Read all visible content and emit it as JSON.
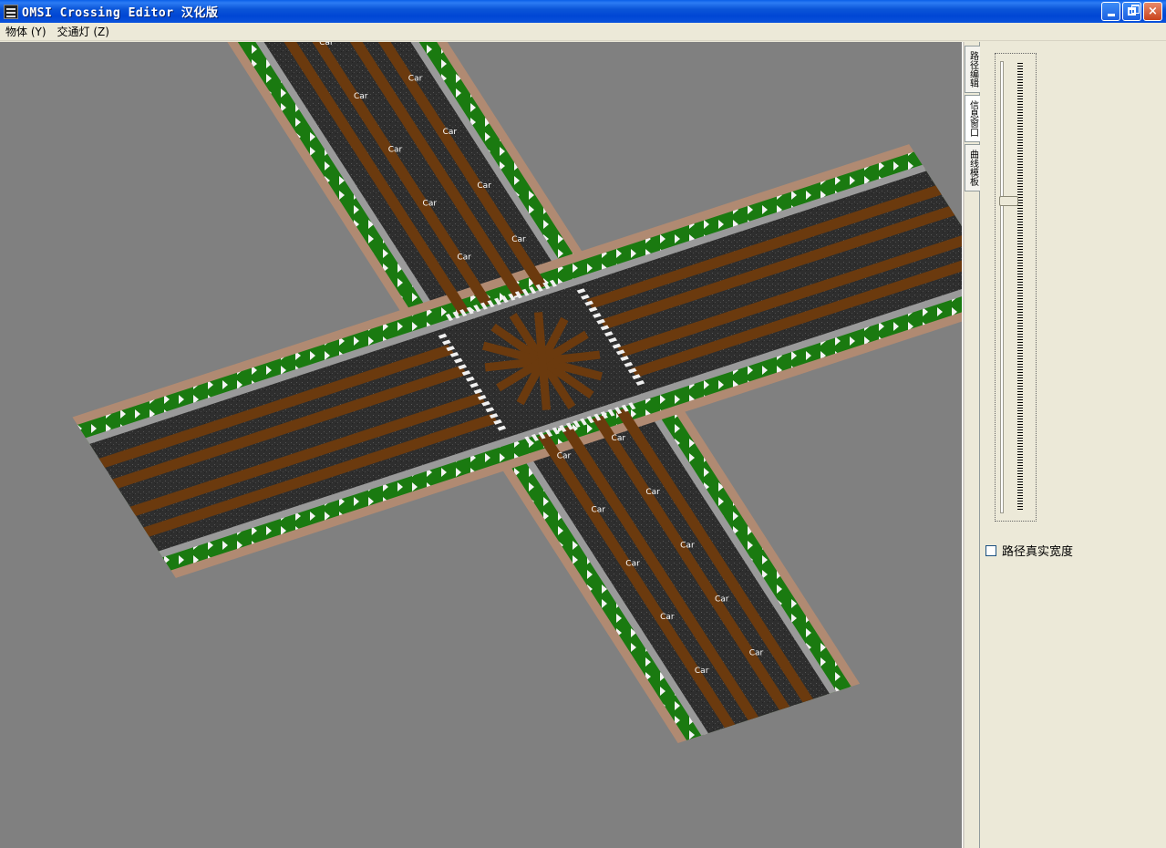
{
  "window": {
    "title": "OMSI Crossing Editor 汉化版",
    "minimize_label": "minimize",
    "maximize_label": "restore",
    "close_label": "×"
  },
  "menu": {
    "items": [
      "物体 (Y)",
      "交通灯 (Z)"
    ]
  },
  "sidepanel": {
    "tabs": [
      "路径编辑",
      "信息窗口",
      "曲线模板"
    ],
    "active_tab": 1,
    "checkbox_label": "路径真实宽度",
    "checkbox_checked": false
  },
  "viewport": {
    "lane_label": "Car"
  },
  "colors": {
    "viewport_bg": "#808080",
    "asphalt": "#2e2e2e",
    "lane_path": "#6b3a0e",
    "sidewalk_path": "#1a7a10",
    "curb": "#9a9a9a",
    "ground": "#b08a72"
  }
}
